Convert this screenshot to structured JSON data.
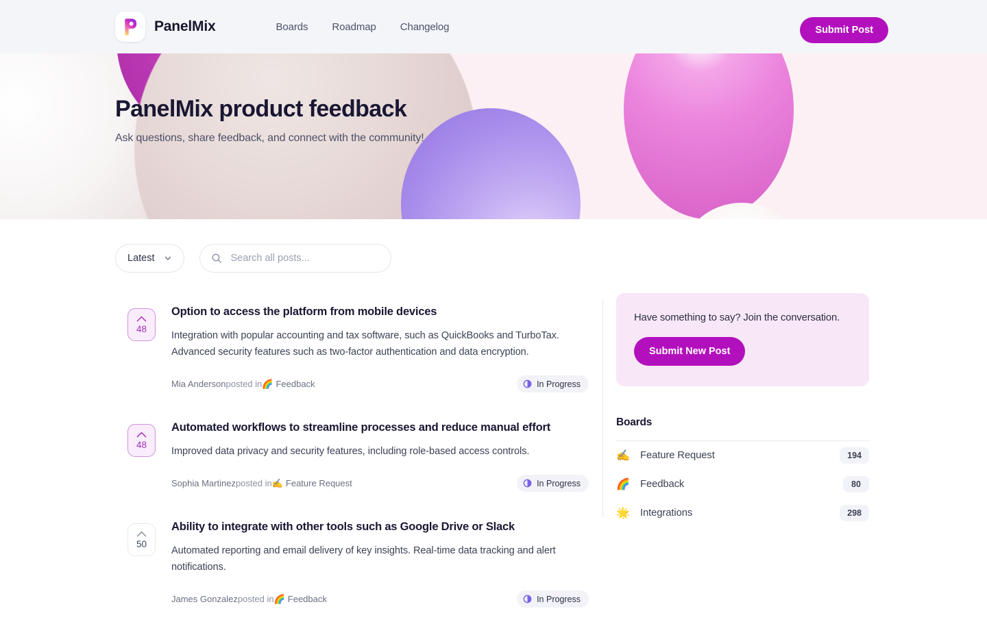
{
  "header": {
    "brand_name": "PanelMix",
    "logo_icon": "panelmix-logo-icon",
    "nav": [
      {
        "label": "Boards"
      },
      {
        "label": "Roadmap"
      },
      {
        "label": "Changelog"
      }
    ],
    "submit_post_label": "Submit Post"
  },
  "hero": {
    "title": "PanelMix product feedback",
    "subtitle": "Ask questions, share feedback, and connect with the community!"
  },
  "toolbar": {
    "sort_value": "Latest",
    "sort_options": [
      "Latest"
    ],
    "chevron_icon": "chevron-down-icon",
    "search_icon": "search-icon",
    "search_value": "",
    "search_placeholder": "Search all posts..."
  },
  "posts": [
    {
      "votes": "48",
      "voted": true,
      "title": "Option to access the platform from mobile devices",
      "description": "Integration with popular accounting and tax software, such as QuickBooks and TurboTax. Advanced security features such as two-factor authentication and data encryption.",
      "author": "Mia Anderson",
      "posted_in": " posted in ",
      "board_emoji": "🌈",
      "board": "Feedback",
      "status": "In Progress",
      "status_icon": "in-progress-icon"
    },
    {
      "votes": "48",
      "voted": true,
      "title": "Automated workflows to streamline processes and reduce manual effort",
      "description": "Improved data privacy and security features, including role-based access controls.",
      "author": "Sophia Martinez",
      "posted_in": " posted in ",
      "board_emoji": "✍️",
      "board": "Feature Request",
      "status": "In Progress",
      "status_icon": "in-progress-icon"
    },
    {
      "votes": "50",
      "voted": false,
      "title": "Ability to integrate with other tools such as Google Drive or Slack",
      "description": "Automated reporting and email delivery of key insights. Real-time data tracking and alert notifications.",
      "author": "James Gonzalez",
      "posted_in": " posted in ",
      "board_emoji": "🌈",
      "board": "Feedback",
      "status": "In Progress",
      "status_icon": "in-progress-icon"
    }
  ],
  "sidebar": {
    "cta_text": "Have something to say? Join the conversation.",
    "cta_button": "Submit New Post",
    "boards_heading": "Boards",
    "boards": [
      {
        "emoji": "✍️",
        "name": "Feature Request",
        "count": "194"
      },
      {
        "emoji": "🌈",
        "name": "Feedback",
        "count": "80"
      },
      {
        "emoji": "🌟",
        "name": "Integrations",
        "count": "298"
      }
    ]
  },
  "colors": {
    "brand_magenta": "#b310bd",
    "accent_purple": "#7b61e8",
    "header_bg": "#f4f5f9",
    "hero_bg": "#fdf0f4",
    "cta_bg": "#f8e8f7"
  }
}
